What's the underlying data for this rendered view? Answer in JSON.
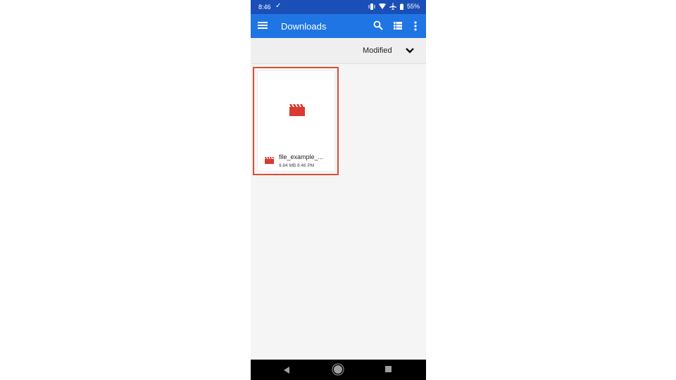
{
  "status_bar": {
    "time": "8:46",
    "notification_icon": "download-done-icon",
    "icons": [
      "vibrate-icon",
      "wifi-icon",
      "airplane-icon",
      "battery-icon"
    ],
    "battery": "55%"
  },
  "app_bar": {
    "menu_icon": "hamburger-menu-icon",
    "title": "Downloads",
    "actions": [
      "search-icon",
      "list-view-icon",
      "more-vert-icon"
    ]
  },
  "sort_bar": {
    "label": "Modified",
    "icon": "chevron-down-icon"
  },
  "files": [
    {
      "name": "file_example_...",
      "size": "9.84 MB",
      "time": "8:46 PM",
      "meta": "9.84 MB 8:46 PM",
      "type_icon": "video-clapperboard-icon",
      "selected": true
    }
  ],
  "colors": {
    "status_bar": "#1a4fb7",
    "app_bar": "#1f75e3",
    "accent_red": "#d93a31",
    "selection_border": "#e14b33"
  },
  "nav_bar": {
    "buttons": [
      "back-icon",
      "home-icon",
      "recents-icon"
    ]
  }
}
